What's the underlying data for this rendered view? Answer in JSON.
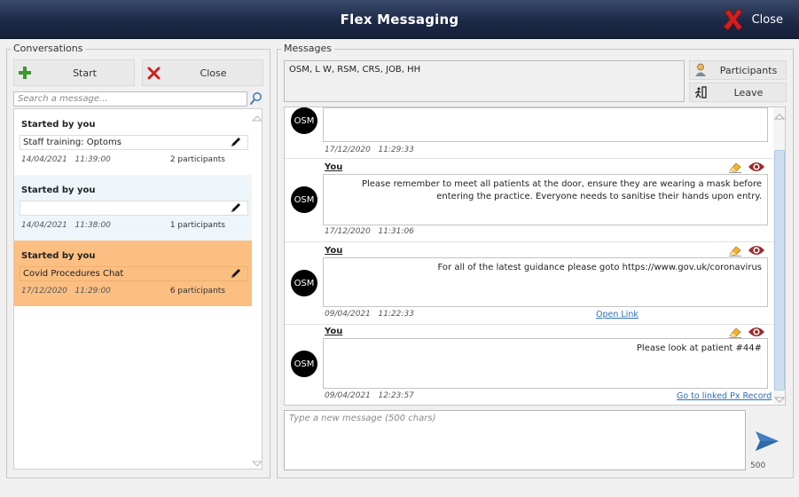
{
  "window": {
    "title": "Flex Messaging",
    "close_label": "Close"
  },
  "conversations": {
    "title": "Conversations",
    "start_label": "Start",
    "close_label": "Close",
    "search_placeholder": "Search a message...",
    "items": [
      {
        "started_by": "Started by you",
        "name": "Staff training: Optoms",
        "date": "14/04/2021",
        "time": "11:39:00",
        "participants": "2 participants",
        "state": "normal"
      },
      {
        "started_by": "Started by you",
        "name": "",
        "date": "14/04/2021",
        "time": "11:38:00",
        "participants": "1 participants",
        "state": "hover"
      },
      {
        "started_by": "Started by you",
        "name": "Covid Procedures Chat",
        "date": "17/12/2020",
        "time": "11:29:00",
        "participants": "6 participants",
        "state": "selected"
      }
    ]
  },
  "messages": {
    "title": "Messages",
    "participants_text": "OSM, L W, RSM, CRS, JOB, HH",
    "participants_label": "Participants",
    "leave_label": "Leave",
    "items": [
      {
        "avatar": "OSM",
        "sender": "",
        "text": "",
        "date": "17/12/2020",
        "time": "11:29:33",
        "link": ""
      },
      {
        "avatar": "OSM",
        "sender": "You",
        "text": "Please remember to meet all patients at the door, ensure they are wearing a mask before entering the practice. Everyone needs to sanitise their hands upon entry.",
        "date": "17/12/2020",
        "time": "11:31:06",
        "link": ""
      },
      {
        "avatar": "OSM",
        "sender": "You",
        "text": "For all of the latest guidance please goto https://www.gov.uk/coronavirus",
        "date": "09/04/2021",
        "time": "11:22:33",
        "link": "Open Link"
      },
      {
        "avatar": "OSM",
        "sender": "You",
        "text": "Please look at patient #44#",
        "date": "09/04/2021",
        "time": "12:23:57",
        "link": "Go to linked Px Record"
      }
    ],
    "compose_placeholder": "Type a new message (500 chars)",
    "char_count": "500"
  },
  "colors": {
    "title_bar": "#1d2a47",
    "selected_conv": "#fbbf82",
    "hover_conv": "#eef6fc",
    "link": "#2a6ebb",
    "send": "#3f7fc1",
    "close_x": "#d02020",
    "start_plus": "#3a9a2a",
    "eye": "#9b2a2a"
  }
}
